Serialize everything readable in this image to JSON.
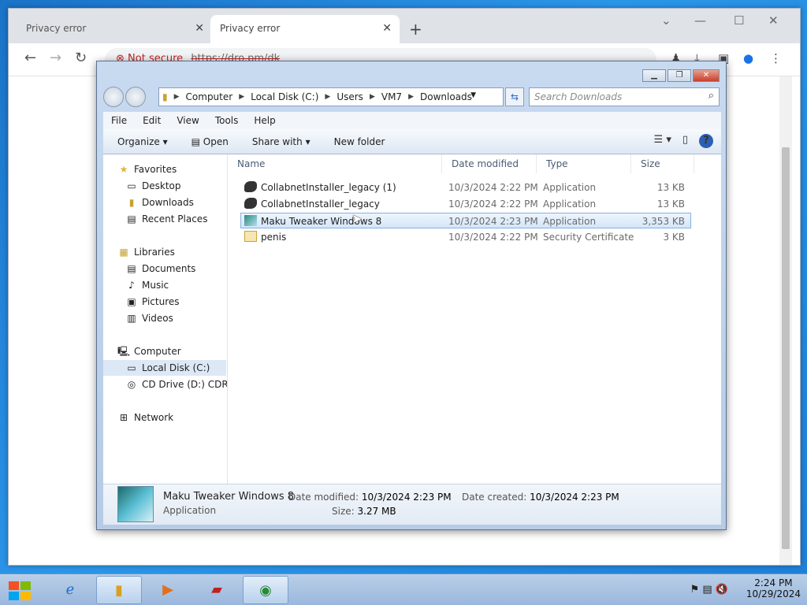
{
  "browser": {
    "tabs": [
      {
        "label": "Privacy error"
      },
      {
        "label": "Privacy error"
      }
    ],
    "omnibox": {
      "security": "Not secure",
      "url": "https://dro.pm/dk"
    }
  },
  "explorer": {
    "breadcrumb": [
      "Computer",
      "Local Disk (C:)",
      "Users",
      "VM7",
      "Downloads"
    ],
    "search_placeholder": "Search Downloads",
    "menu": [
      "File",
      "Edit",
      "View",
      "Tools",
      "Help"
    ],
    "commands": {
      "organize": "Organize",
      "open": "Open",
      "share": "Share with",
      "new_folder": "New folder"
    },
    "nav": {
      "favorites": "Favorites",
      "desktop": "Desktop",
      "downloads": "Downloads",
      "recent": "Recent Places",
      "libraries": "Libraries",
      "documents": "Documents",
      "music": "Music",
      "pictures": "Pictures",
      "videos": "Videos",
      "computer": "Computer",
      "local_disk": "Local Disk (C:)",
      "cd_drive": "CD Drive (D:) CDROM",
      "network": "Network"
    },
    "columns": {
      "name": "Name",
      "date": "Date modified",
      "type": "Type",
      "size": "Size"
    },
    "files": [
      {
        "name": "CollabnetInstaller_legacy (1)",
        "date": "10/3/2024 2:22 PM",
        "type": "Application",
        "size": "13 KB"
      },
      {
        "name": "CollabnetInstaller_legacy",
        "date": "10/3/2024 2:22 PM",
        "type": "Application",
        "size": "13 KB"
      },
      {
        "name": "Maku Tweaker Windows 8",
        "date": "10/3/2024 2:23 PM",
        "type": "Application",
        "size": "3,353 KB"
      },
      {
        "name": "penis",
        "date": "10/3/2024 2:22 PM",
        "type": "Security Certificate",
        "size": "3 KB"
      }
    ],
    "details": {
      "name": "Maku Tweaker Windows 8",
      "type": "Application",
      "modified_label": "Date modified:",
      "modified": "10/3/2024 2:23 PM",
      "created_label": "Date created:",
      "created": "10/3/2024 2:23 PM",
      "size_label": "Size:",
      "size": "3.27 MB"
    }
  },
  "taskbar": {
    "time": "2:24 PM",
    "date": "10/29/2024"
  }
}
